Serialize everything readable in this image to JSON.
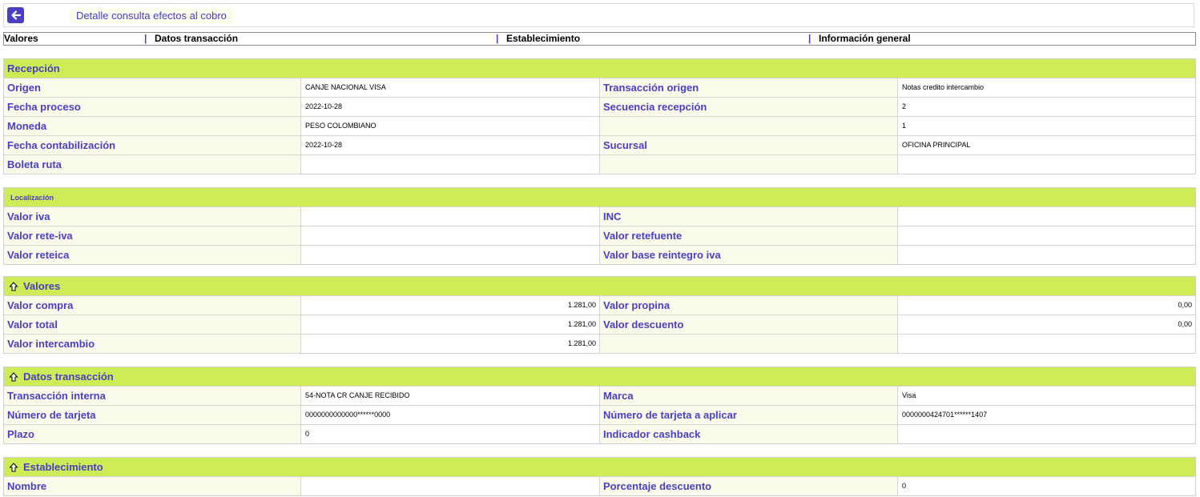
{
  "header": {
    "title": "Detalle consulta efectos al cobro",
    "back_icon": "arrow-left-icon"
  },
  "tabs": [
    "Valores",
    "Datos transacción",
    "Establecimiento",
    "Información general"
  ],
  "tab_separator": "|",
  "colors": {
    "accent": "#4a3fc4",
    "section_header": "#cdec55",
    "label_bg": "#fbfbeb"
  },
  "sections": {
    "recepcion": {
      "title": "Recepción",
      "rows": [
        [
          "Origen",
          "CANJE NACIONAL VISA",
          "Transacción origen",
          "Notas credito intercambio"
        ],
        [
          "Fecha proceso",
          "2022-10-28",
          "Secuencia recepción",
          "2"
        ],
        [
          "Moneda",
          "PESO COLOMBIANO",
          "",
          "1"
        ],
        [
          "Fecha contabilización",
          "2022-10-28",
          "Sucursal",
          "OFICINA PRINCIPAL"
        ],
        [
          "Boleta ruta",
          "",
          "",
          ""
        ]
      ]
    },
    "localizacion": {
      "title": "Localización",
      "rows": [
        [
          "Valor iva",
          "",
          "INC",
          ""
        ],
        [
          "Valor rete-iva",
          "",
          "Valor retefuente",
          ""
        ],
        [
          "Valor reteica",
          "",
          "Valor base reintegro iva",
          ""
        ]
      ]
    },
    "valores": {
      "title": "Valores",
      "rows": [
        [
          "Valor compra",
          "1.281,00",
          "Valor propina",
          "0,00"
        ],
        [
          "Valor total",
          "1.281,00",
          "Valor descuento",
          "0,00"
        ],
        [
          "Valor intercambio",
          "1.281,00",
          "",
          ""
        ]
      ]
    },
    "datos_transaccion": {
      "title": "Datos transacción",
      "rows": [
        [
          "Transacción interna",
          "54-NOTA CR CANJE RECIBIDO",
          "Marca",
          "Visa"
        ],
        [
          "Número de tarjeta",
          "0000000000000******0000",
          "Número de tarjeta a aplicar",
          "0000000424701******1407"
        ],
        [
          "Plazo",
          "0",
          "Indicador cashback",
          ""
        ]
      ]
    },
    "establecimiento": {
      "title": "Establecimiento",
      "rows": [
        [
          "Nombre",
          "",
          "Porcentaje descuento",
          "0"
        ]
      ]
    }
  }
}
